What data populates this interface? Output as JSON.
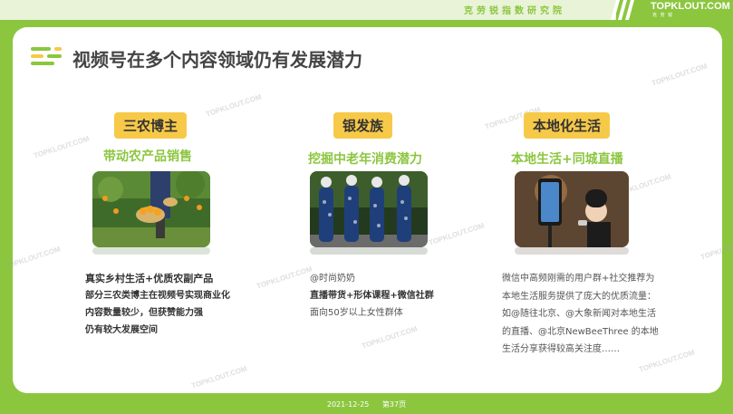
{
  "header": {
    "institute": "克劳锐指数研究院",
    "brand": "TOPKLOUT.COM",
    "brand_sub": "克 劳 锐"
  },
  "page_title": "视频号在多个内容领域仍有发展潜力",
  "watermark": "TOPKLOUT.COM",
  "columns": [
    {
      "tag": "三农博主",
      "subtitle": "带动农产品销售",
      "photo_icon": "farmer-harvest-photo",
      "lines": [
        "真实乡村生活+优质农副产品",
        "部分三农类博主在视频号实现商业化",
        "内容数量较少，但获赞能力强",
        "仍有较大发展空间"
      ]
    },
    {
      "tag": "银发族",
      "subtitle": "挖掘中老年消费潜力",
      "photo_icon": "elderly-women-qipao-photo",
      "lines": [
        "@时尚奶奶",
        "直播带货+形体课程+微信社群",
        "面向50岁以上女性群体"
      ]
    },
    {
      "tag": "本地化生活",
      "subtitle": "本地生活+同城直播",
      "photo_icon": "livestream-phone-photo",
      "lines": [
        "微信中高频刚需的用户群+社交推荐为",
        "本地生活服务提供了庞大的优质流量：",
        "如@随往北京、@大象新闻对本地生活",
        "的直播、@北京NewBeeThree 的本地",
        "生活分享获得较高关注度……"
      ]
    }
  ],
  "footer": {
    "date": "2021-12-25",
    "page": "第37页"
  },
  "colors": {
    "accent_green": "#8cc63f",
    "tag_yellow": "#f7c948",
    "title_gray": "#444444"
  }
}
